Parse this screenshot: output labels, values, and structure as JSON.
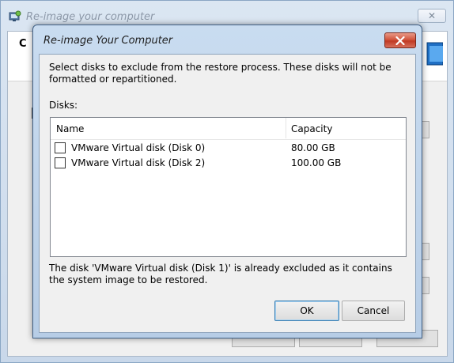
{
  "background_window": {
    "title": "Re-image your computer",
    "close_glyph": "✕",
    "header_letter": "C"
  },
  "dialog": {
    "title": "Re-image Your Computer",
    "instructions": "Select disks to exclude from the restore process. These disks will not be formatted or repartitioned.",
    "disks_label": "Disks:",
    "columns": {
      "name": "Name",
      "capacity": "Capacity"
    },
    "disks": [
      {
        "name": "VMware Virtual disk (Disk 0)",
        "capacity": "80.00 GB",
        "checked": false
      },
      {
        "name": "VMware Virtual disk (Disk 2)",
        "capacity": "100.00 GB",
        "checked": false
      }
    ],
    "footnote": "The disk 'VMware Virtual disk (Disk 1)' is already excluded as it contains the system image to be restored.",
    "ok_label": "OK",
    "cancel_label": "Cancel"
  },
  "colors": {
    "close_button_red": "#c03a24",
    "title_bar_blue": "#c9dcf0",
    "default_button_border": "#3c7fb1"
  },
  "icons": [
    "restore-app-icon",
    "monitor-icon",
    "close-icon"
  ]
}
